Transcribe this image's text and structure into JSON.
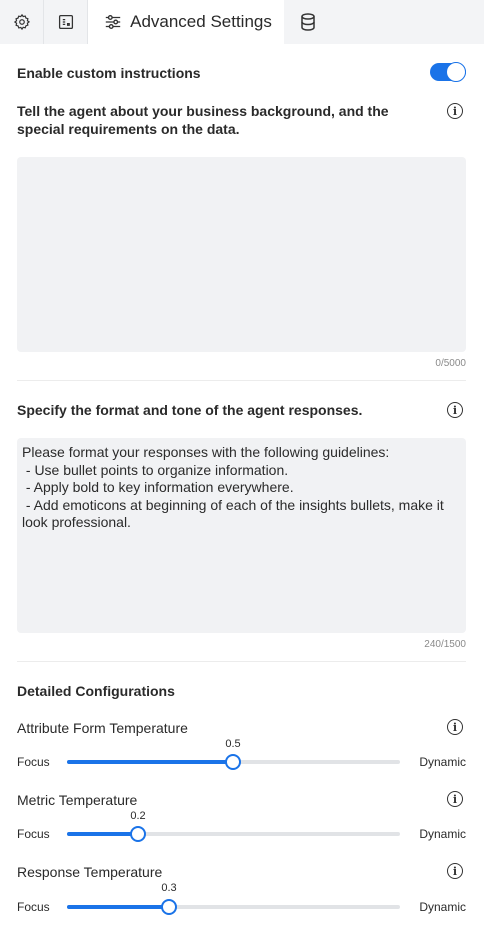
{
  "tabs": {
    "active_label": "Advanced Settings",
    "icons": [
      "gear-icon",
      "dashboard-icon",
      "sliders-icon",
      "database-icon"
    ]
  },
  "custom_instructions": {
    "label": "Enable custom instructions",
    "enabled": true
  },
  "business_background": {
    "label": "Tell the agent about your business background, and the special requirements on the data.",
    "value": "",
    "counter": "0/5000"
  },
  "response_format": {
    "label": "Specify the format and tone of the agent responses.",
    "value": "Please format your responses with the following guidelines:\n - Use bullet points to organize information.\n - Apply bold to key information everywhere.\n - Add emoticons at beginning of each of the insights bullets, make it look professional.",
    "counter": "240/1500"
  },
  "detailed": {
    "heading": "Detailed Configurations",
    "focus_label": "Focus",
    "dynamic_label": "Dynamic",
    "sliders": [
      {
        "label": "Attribute Form Temperature",
        "value": "0.5",
        "fraction": 0.5
      },
      {
        "label": "Metric Temperature",
        "value": "0.2",
        "fraction": 0.2
      },
      {
        "label": "Response Temperature",
        "value": "0.3",
        "fraction": 0.3
      }
    ]
  },
  "colors": {
    "accent": "#1a73e8",
    "field_bg": "#f1f2f4",
    "tabbar_bg": "#f3f4f6"
  }
}
